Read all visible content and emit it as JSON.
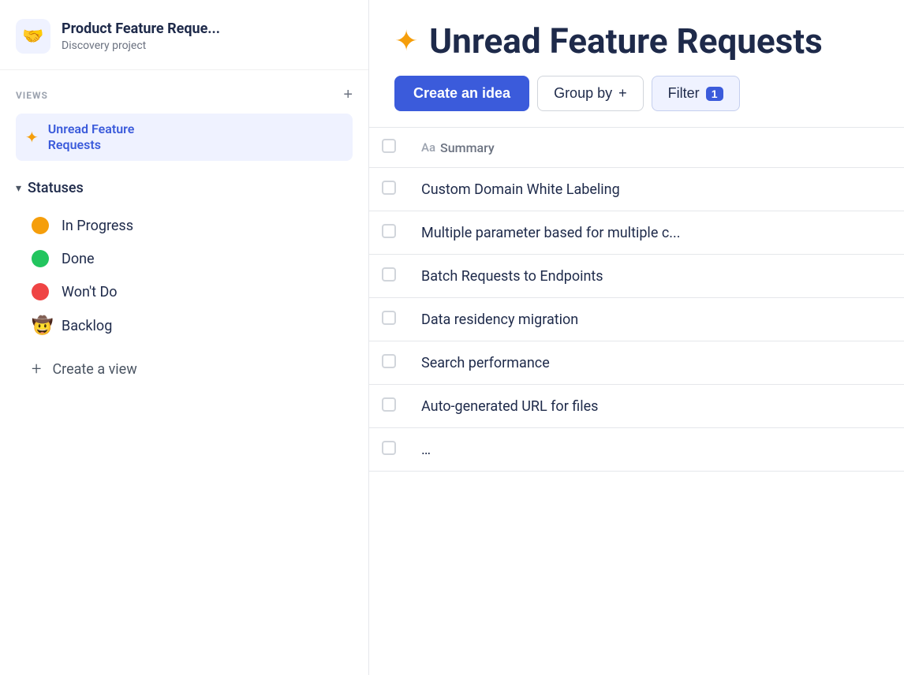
{
  "sidebar": {
    "project_icon": "🤝",
    "project_title": "Product Feature Reque...",
    "project_subtitle": "Discovery project",
    "views_label": "VIEWS",
    "add_view_icon": "+",
    "active_view_icon": "✦",
    "active_view_label": "Unread Feature\nRequests",
    "statuses_label": "Statuses",
    "chevron": "▾",
    "statuses": [
      {
        "id": "in-progress",
        "color": "yellow",
        "label": "In Progress",
        "emoji": null
      },
      {
        "id": "done",
        "color": "green",
        "label": "Done",
        "emoji": null
      },
      {
        "id": "wont-do",
        "color": "red",
        "label": "Won't Do",
        "emoji": null
      },
      {
        "id": "backlog",
        "color": "emoji",
        "label": "Backlog",
        "emoji": "🤠"
      }
    ],
    "create_view_icon": "+",
    "create_view_label": "Create a view"
  },
  "main": {
    "sparkle": "✦",
    "page_title": "Unread Feature Requests",
    "toolbar": {
      "create_label": "Create an idea",
      "group_by_label": "Group by",
      "group_by_plus": "+",
      "filter_label": "Filter",
      "filter_count": "1"
    },
    "table": {
      "summary_header": "Summary",
      "summary_icon": "Aa",
      "rows": [
        {
          "id": 1,
          "title": "Custom Domain White Labeling"
        },
        {
          "id": 2,
          "title": "Multiple parameter based for multiple c..."
        },
        {
          "id": 3,
          "title": "Batch Requests to Endpoints"
        },
        {
          "id": 4,
          "title": "Data residency migration"
        },
        {
          "id": 5,
          "title": "Search performance"
        },
        {
          "id": 6,
          "title": "Auto-generated URL for files"
        },
        {
          "id": 7,
          "title": "..."
        }
      ]
    }
  }
}
